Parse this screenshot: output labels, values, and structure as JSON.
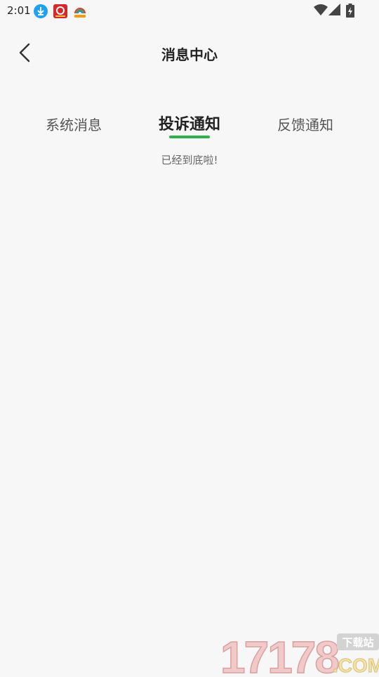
{
  "status_bar": {
    "time": "2:01",
    "icons": [
      "download-icon",
      "app-red-icon",
      "app-rainbow-icon",
      "wifi-icon",
      "signal-icon",
      "battery-icon"
    ]
  },
  "header": {
    "title": "消息中心",
    "back_icon": "chevron-left-icon"
  },
  "tabs": [
    {
      "label": "系统消息",
      "active": false
    },
    {
      "label": "投诉通知",
      "active": true
    },
    {
      "label": "反馈通知",
      "active": false
    }
  ],
  "list": {
    "end_text": "已经到底啦!"
  },
  "watermark": {
    "number": "17178",
    "site": "下载站",
    "domain": ".COM"
  },
  "colors": {
    "accent": "#2bb24c",
    "background": "#f7f7f7"
  }
}
